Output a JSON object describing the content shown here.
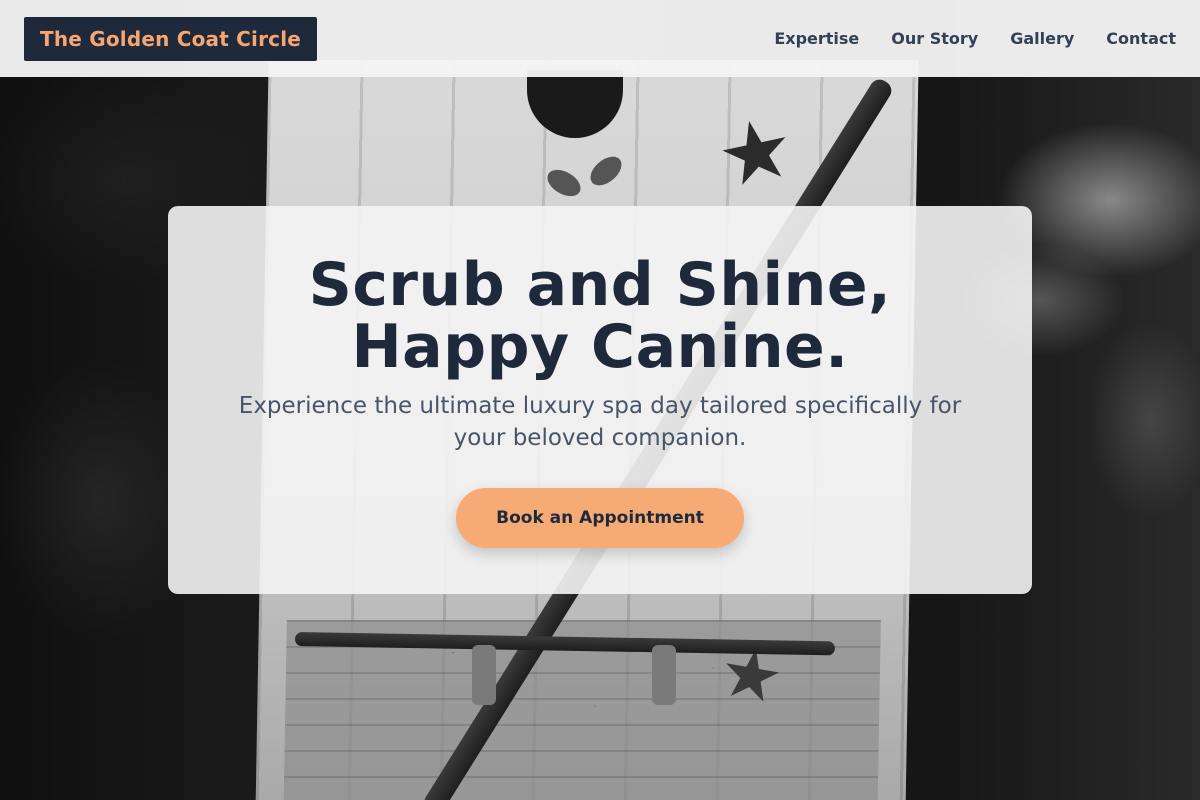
{
  "header": {
    "brand": "The Golden Coat Circle",
    "nav": [
      {
        "label": "Expertise"
      },
      {
        "label": "Our Story"
      },
      {
        "label": "Gallery"
      },
      {
        "label": "Contact"
      }
    ]
  },
  "hero": {
    "title_line1": "Scrub and Shine,",
    "title_line2": "Happy Canine.",
    "subtitle": "Experience the ultimate luxury spa day tailored specifically for your beloved companion.",
    "cta_label": "Book an Appointment"
  },
  "colors": {
    "brand_bg": "#1e293b",
    "brand_text": "#f6a670",
    "accent": "#f6ab75",
    "nav_text": "#334155",
    "heading": "#1e293b",
    "body_text": "#475569"
  },
  "icons": {
    "background": "monochrome-photo-painted-wooden-board",
    "decorations": [
      "star-icon",
      "flower-icon"
    ]
  }
}
